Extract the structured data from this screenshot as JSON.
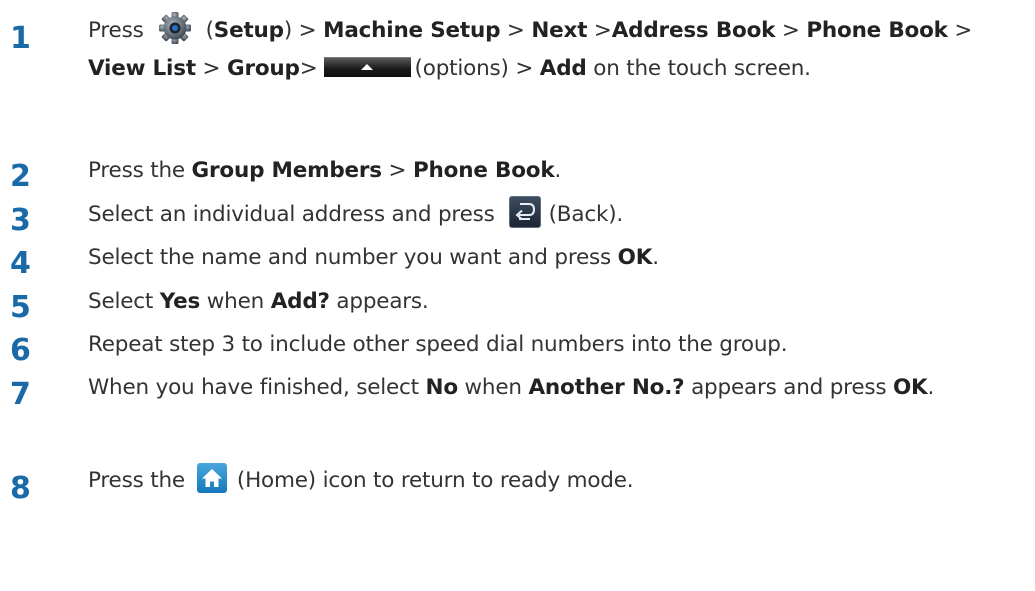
{
  "steps": [
    {
      "number": "1",
      "t1": "Press",
      "icon1": "setup-gear-icon",
      "t2": "(",
      "b1": "Setup",
      "t3": ") > ",
      "b2": "Machine Setup",
      "t4": " > ",
      "b3": "Next",
      "t5": " >",
      "b4": "Address Book",
      "t6": " > ",
      "b5": "Phone Book",
      "t7": " > ",
      "b6": "View List",
      "t8": " > ",
      "b7": "Group",
      "t9": ">",
      "icon2": "options-bar-icon",
      "t10": "(options) > ",
      "b8": "Add",
      "t11": " on the touch screen."
    },
    {
      "number": "2",
      "t1": "Press the ",
      "b1": "Group Members",
      "t2": " > ",
      "b2": "Phone Book",
      "t3": "."
    },
    {
      "number": "3",
      "t1": "Select an individual address and press",
      "icon1": "back-icon",
      "t2": "(Back)."
    },
    {
      "number": "4",
      "t1": "Select the name and number you want and press ",
      "b1": "OK",
      "t2": "."
    },
    {
      "number": "5",
      "t1": "Select ",
      "b1": "Yes",
      "t2": " when ",
      "b2": "Add?",
      "t3": " appears."
    },
    {
      "number": "6",
      "t1": "Repeat step 3 to include other speed dial numbers into the group."
    },
    {
      "number": "7",
      "t1": "When you have finished, select ",
      "b1": "No",
      "t2": " when ",
      "b2": "Another No.?",
      "t3": " appears and press ",
      "b3": "OK",
      "t4": "."
    },
    {
      "number": "8",
      "t1": "Press the",
      "icon1": "home-icon",
      "t2": "(Home) icon to return to ready mode."
    }
  ],
  "colors": {
    "step_number": "#1a6aa8",
    "body_text": "#333333"
  }
}
